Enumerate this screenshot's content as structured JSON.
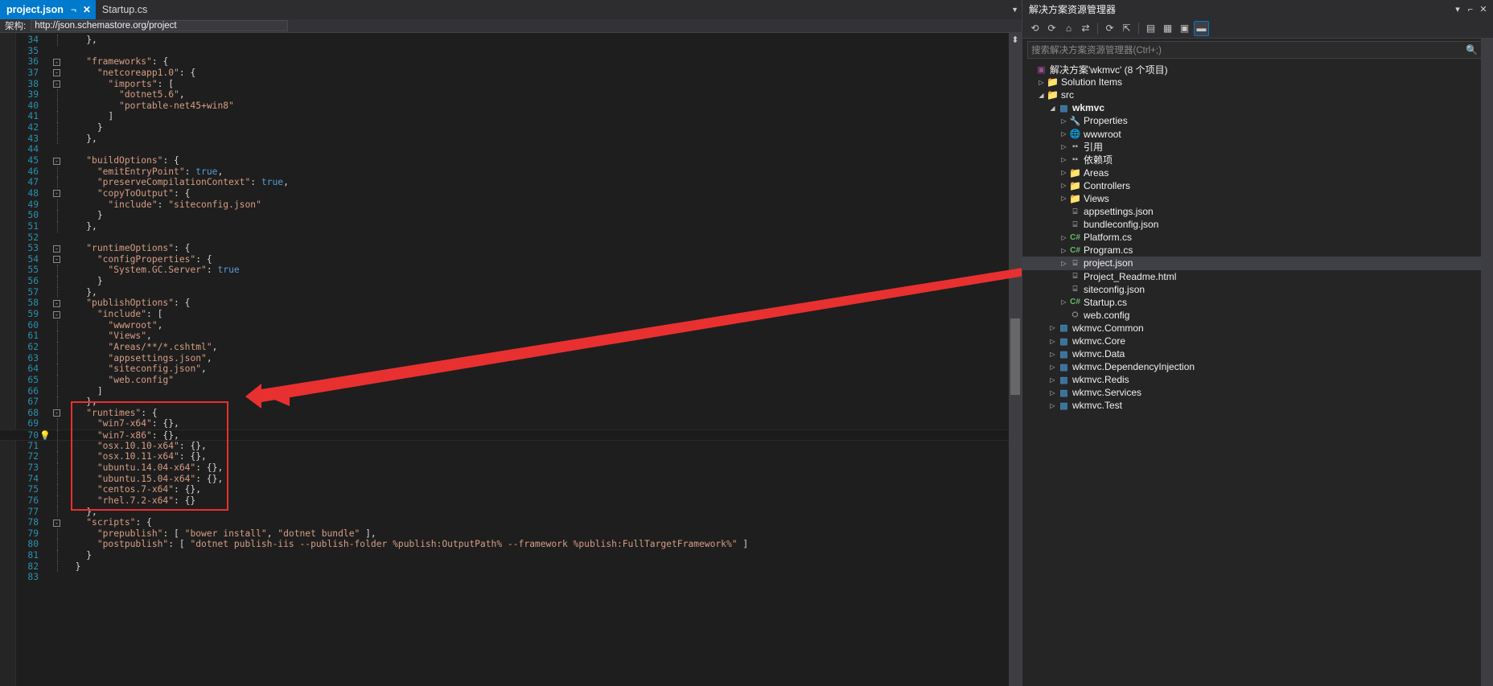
{
  "window": {
    "editor_tabs": [
      {
        "label": "project.json",
        "active": true,
        "pin_icon": "pin-icon",
        "close_icon": "close-icon"
      },
      {
        "label": "Startup.cs",
        "active": false
      }
    ],
    "tab_overflow_icon": "chevron-down-icon"
  },
  "schema_bar": {
    "label": "架构:",
    "value": "http://json.schemastore.org/project"
  },
  "editor": {
    "current_line": 70,
    "lightbulb_line": 70,
    "lightbulb_icon": "lightbulb-icon",
    "lines": [
      {
        "n": 34,
        "fold": "",
        "guide": "dotted",
        "indent": 4,
        "tokens": [
          [
            "punc",
            "},"
          ]
        ]
      },
      {
        "n": 35,
        "fold": "",
        "guide": "",
        "indent": 0,
        "tokens": []
      },
      {
        "n": 36,
        "fold": "-",
        "guide": "dotted",
        "indent": 4,
        "tokens": [
          [
            "str",
            "\"frameworks\""
          ],
          [
            "punc",
            ": {"
          ]
        ]
      },
      {
        "n": 37,
        "fold": "-",
        "guide": "dotted",
        "indent": 6,
        "tokens": [
          [
            "str",
            "\"netcoreapp1.0\""
          ],
          [
            "punc",
            ": {"
          ]
        ]
      },
      {
        "n": 38,
        "fold": "-",
        "guide": "dotted",
        "indent": 8,
        "tokens": [
          [
            "str",
            "\"imports\""
          ],
          [
            "punc",
            ": ["
          ]
        ]
      },
      {
        "n": 39,
        "fold": "",
        "guide": "dotted",
        "indent": 10,
        "tokens": [
          [
            "str",
            "\"dotnet5.6\""
          ],
          [
            "punc",
            ","
          ]
        ]
      },
      {
        "n": 40,
        "fold": "",
        "guide": "dotted",
        "indent": 10,
        "tokens": [
          [
            "str",
            "\"portable-net45+win8\""
          ]
        ]
      },
      {
        "n": 41,
        "fold": "",
        "guide": "dotted",
        "indent": 8,
        "tokens": [
          [
            "punc",
            "]"
          ]
        ]
      },
      {
        "n": 42,
        "fold": "",
        "guide": "dotted",
        "indent": 6,
        "tokens": [
          [
            "punc",
            "}"
          ]
        ]
      },
      {
        "n": 43,
        "fold": "",
        "guide": "dotted",
        "indent": 4,
        "tokens": [
          [
            "punc",
            "},"
          ]
        ]
      },
      {
        "n": 44,
        "fold": "",
        "guide": "",
        "indent": 0,
        "tokens": []
      },
      {
        "n": 45,
        "fold": "-",
        "guide": "dotted",
        "indent": 4,
        "tokens": [
          [
            "str",
            "\"buildOptions\""
          ],
          [
            "punc",
            ": {"
          ]
        ]
      },
      {
        "n": 46,
        "fold": "",
        "guide": "dotted",
        "indent": 6,
        "tokens": [
          [
            "str",
            "\"emitEntryPoint\""
          ],
          [
            "punc",
            ": "
          ],
          [
            "bool",
            "true"
          ],
          [
            "punc",
            ","
          ]
        ]
      },
      {
        "n": 47,
        "fold": "",
        "guide": "dotted",
        "indent": 6,
        "tokens": [
          [
            "str",
            "\"preserveCompilationContext\""
          ],
          [
            "punc",
            ": "
          ],
          [
            "bool",
            "true"
          ],
          [
            "punc",
            ","
          ]
        ]
      },
      {
        "n": 48,
        "fold": "-",
        "guide": "dotted",
        "indent": 6,
        "tokens": [
          [
            "str",
            "\"copyToOutput\""
          ],
          [
            "punc",
            ": {"
          ]
        ]
      },
      {
        "n": 49,
        "fold": "",
        "guide": "dotted",
        "indent": 8,
        "tokens": [
          [
            "str",
            "\"include\""
          ],
          [
            "punc",
            ": "
          ],
          [
            "str",
            "\"siteconfig.json\""
          ]
        ]
      },
      {
        "n": 50,
        "fold": "",
        "guide": "dotted",
        "indent": 6,
        "tokens": [
          [
            "punc",
            "}"
          ]
        ]
      },
      {
        "n": 51,
        "fold": "",
        "guide": "dotted",
        "indent": 4,
        "tokens": [
          [
            "punc",
            "},"
          ]
        ]
      },
      {
        "n": 52,
        "fold": "",
        "guide": "",
        "indent": 0,
        "tokens": []
      },
      {
        "n": 53,
        "fold": "-",
        "guide": "dotted",
        "indent": 4,
        "tokens": [
          [
            "str",
            "\"runtimeOptions\""
          ],
          [
            "punc",
            ": {"
          ]
        ]
      },
      {
        "n": 54,
        "fold": "-",
        "guide": "dotted",
        "indent": 6,
        "tokens": [
          [
            "str",
            "\"configProperties\""
          ],
          [
            "punc",
            ": {"
          ]
        ]
      },
      {
        "n": 55,
        "fold": "",
        "guide": "dotted",
        "indent": 8,
        "tokens": [
          [
            "str",
            "\"System.GC.Server\""
          ],
          [
            "punc",
            ": "
          ],
          [
            "bool",
            "true"
          ]
        ]
      },
      {
        "n": 56,
        "fold": "",
        "guide": "dotted",
        "indent": 6,
        "tokens": [
          [
            "punc",
            "}"
          ]
        ]
      },
      {
        "n": 57,
        "fold": "",
        "guide": "dotted",
        "indent": 4,
        "tokens": [
          [
            "punc",
            "},"
          ]
        ]
      },
      {
        "n": 58,
        "fold": "-",
        "guide": "dotted",
        "indent": 4,
        "tokens": [
          [
            "str",
            "\"publishOptions\""
          ],
          [
            "punc",
            ": {"
          ]
        ]
      },
      {
        "n": 59,
        "fold": "-",
        "guide": "dotted",
        "indent": 6,
        "tokens": [
          [
            "str",
            "\"include\""
          ],
          [
            "punc",
            ": ["
          ]
        ]
      },
      {
        "n": 60,
        "fold": "",
        "guide": "dotted",
        "indent": 8,
        "tokens": [
          [
            "str",
            "\"wwwroot\""
          ],
          [
            "punc",
            ","
          ]
        ]
      },
      {
        "n": 61,
        "fold": "",
        "guide": "dotted",
        "indent": 8,
        "tokens": [
          [
            "str",
            "\"Views\""
          ],
          [
            "punc",
            ","
          ]
        ]
      },
      {
        "n": 62,
        "fold": "",
        "guide": "dotted",
        "indent": 8,
        "tokens": [
          [
            "str",
            "\"Areas/**/*.cshtml\""
          ],
          [
            "punc",
            ","
          ]
        ]
      },
      {
        "n": 63,
        "fold": "",
        "guide": "dotted",
        "indent": 8,
        "tokens": [
          [
            "str",
            "\"appsettings.json\""
          ],
          [
            "punc",
            ","
          ]
        ]
      },
      {
        "n": 64,
        "fold": "",
        "guide": "dotted",
        "indent": 8,
        "tokens": [
          [
            "str",
            "\"siteconfig.json\""
          ],
          [
            "punc",
            ","
          ]
        ]
      },
      {
        "n": 65,
        "fold": "",
        "guide": "dotted",
        "indent": 8,
        "tokens": [
          [
            "str",
            "\"web.config\""
          ]
        ]
      },
      {
        "n": 66,
        "fold": "",
        "guide": "dotted",
        "indent": 6,
        "tokens": [
          [
            "punc",
            "]"
          ]
        ]
      },
      {
        "n": 67,
        "fold": "",
        "guide": "dotted",
        "indent": 4,
        "tokens": [
          [
            "punc",
            "},"
          ]
        ]
      },
      {
        "n": 68,
        "fold": "-",
        "guide": "dotted",
        "indent": 4,
        "tokens": [
          [
            "str",
            "\"runtimes\""
          ],
          [
            "punc",
            ": {"
          ]
        ]
      },
      {
        "n": 69,
        "fold": "",
        "guide": "dotted",
        "indent": 6,
        "tokens": [
          [
            "str",
            "\"win7-x64\""
          ],
          [
            "punc",
            ": {},"
          ]
        ]
      },
      {
        "n": 70,
        "fold": "",
        "guide": "dotted",
        "indent": 6,
        "tokens": [
          [
            "str",
            "\"win7-x86\""
          ],
          [
            "punc",
            ": {},"
          ]
        ]
      },
      {
        "n": 71,
        "fold": "",
        "guide": "dotted",
        "indent": 6,
        "tokens": [
          [
            "str",
            "\"osx.10.10-x64\""
          ],
          [
            "punc",
            ": {},"
          ]
        ]
      },
      {
        "n": 72,
        "fold": "",
        "guide": "dotted",
        "indent": 6,
        "tokens": [
          [
            "str",
            "\"osx.10.11-x64\""
          ],
          [
            "punc",
            ": {},"
          ]
        ]
      },
      {
        "n": 73,
        "fold": "",
        "guide": "dotted",
        "indent": 6,
        "tokens": [
          [
            "str",
            "\"ubuntu.14.04-x64\""
          ],
          [
            "punc",
            ": {},"
          ]
        ]
      },
      {
        "n": 74,
        "fold": "",
        "guide": "dotted",
        "indent": 6,
        "tokens": [
          [
            "str",
            "\"ubuntu.15.04-x64\""
          ],
          [
            "punc",
            ": {},"
          ]
        ]
      },
      {
        "n": 75,
        "fold": "",
        "guide": "dotted",
        "indent": 6,
        "tokens": [
          [
            "str",
            "\"centos.7-x64\""
          ],
          [
            "punc",
            ": {},"
          ]
        ]
      },
      {
        "n": 76,
        "fold": "",
        "guide": "dotted",
        "indent": 6,
        "tokens": [
          [
            "str",
            "\"rhel.7.2-x64\""
          ],
          [
            "punc",
            ": {}"
          ]
        ]
      },
      {
        "n": 77,
        "fold": "",
        "guide": "dotted",
        "indent": 4,
        "tokens": [
          [
            "punc",
            "},"
          ]
        ]
      },
      {
        "n": 78,
        "fold": "-",
        "guide": "dotted",
        "indent": 4,
        "tokens": [
          [
            "str",
            "\"scripts\""
          ],
          [
            "punc",
            ": {"
          ]
        ]
      },
      {
        "n": 79,
        "fold": "",
        "guide": "dotted",
        "indent": 6,
        "tokens": [
          [
            "str",
            "\"prepublish\""
          ],
          [
            "punc",
            ": [ "
          ],
          [
            "str",
            "\"bower install\""
          ],
          [
            "punc",
            ", "
          ],
          [
            "str",
            "\"dotnet bundle\""
          ],
          [
            "punc",
            " ],"
          ]
        ]
      },
      {
        "n": 80,
        "fold": "",
        "guide": "dotted",
        "indent": 6,
        "tokens": [
          [
            "str",
            "\"postpublish\""
          ],
          [
            "punc",
            ": [ "
          ],
          [
            "str",
            "\"dotnet publish-iis --publish-folder %publish:OutputPath% --framework %publish:FullTargetFramework%\""
          ],
          [
            "punc",
            " ]"
          ]
        ]
      },
      {
        "n": 81,
        "fold": "",
        "guide": "dotted",
        "indent": 4,
        "tokens": [
          [
            "punc",
            "}"
          ]
        ]
      },
      {
        "n": 82,
        "fold": "",
        "guide": "dotted",
        "indent": 2,
        "tokens": [
          [
            "punc",
            "}"
          ]
        ]
      },
      {
        "n": 83,
        "fold": "",
        "guide": "",
        "indent": 0,
        "tokens": []
      }
    ]
  },
  "annotation": {
    "box_label": "runtimes-highlight-box",
    "arrow_label": "pointer-arrow",
    "color": "#e83030"
  },
  "solution_explorer": {
    "title": "解决方案资源管理器",
    "title_buttons": [
      {
        "icon": "chevron-down-icon"
      },
      {
        "icon": "pin-icon"
      },
      {
        "icon": "close-icon"
      }
    ],
    "toolbar": [
      {
        "icon": "back-icon",
        "active": false
      },
      {
        "icon": "forward-icon",
        "active": false
      },
      {
        "icon": "home-icon",
        "active": false
      },
      {
        "icon": "sync-icon",
        "active": false
      },
      {
        "icon": "refresh-icon",
        "active": false
      },
      {
        "icon": "collapse-all-icon",
        "active": false
      },
      {
        "icon": "show-all-files-icon",
        "active": false
      },
      {
        "icon": "properties-icon",
        "active": false
      },
      {
        "icon": "preview-selected-icon",
        "active": false
      },
      {
        "icon": "pending-changes-icon",
        "active": true
      }
    ],
    "search": {
      "placeholder": "搜索解决方案资源管理器(Ctrl+;)",
      "search_icon": "search-icon",
      "dropdown_icon": "chevron-down-icon"
    },
    "tree": [
      {
        "depth": 0,
        "twisty": "none",
        "icon": "solution-icon",
        "label": "解决方案'wkmvc' (8 个项目)",
        "selected": false
      },
      {
        "depth": 1,
        "twisty": "collapsed",
        "icon": "folder-icon",
        "label": "Solution Items",
        "selected": false
      },
      {
        "depth": 1,
        "twisty": "expanded",
        "icon": "folder-icon",
        "label": "src",
        "selected": false
      },
      {
        "depth": 2,
        "twisty": "expanded",
        "icon": "project-icon",
        "label": "wkmvc",
        "selected": false,
        "bold": true
      },
      {
        "depth": 3,
        "twisty": "collapsed",
        "icon": "properties-icon",
        "label": "Properties",
        "selected": false
      },
      {
        "depth": 3,
        "twisty": "collapsed",
        "icon": "wwwroot-icon",
        "label": "wwwroot",
        "selected": false
      },
      {
        "depth": 3,
        "twisty": "collapsed",
        "icon": "references-icon",
        "label": "引用",
        "selected": false
      },
      {
        "depth": 3,
        "twisty": "collapsed",
        "icon": "dependencies-icon",
        "label": "依赖项",
        "selected": false
      },
      {
        "depth": 3,
        "twisty": "collapsed",
        "icon": "folder-icon",
        "label": "Areas",
        "selected": false
      },
      {
        "depth": 3,
        "twisty": "collapsed",
        "icon": "folder-icon",
        "label": "Controllers",
        "selected": false
      },
      {
        "depth": 3,
        "twisty": "collapsed",
        "icon": "folder-icon",
        "label": "Views",
        "selected": false
      },
      {
        "depth": 3,
        "twisty": "none",
        "icon": "json-file-icon",
        "label": "appsettings.json",
        "selected": false
      },
      {
        "depth": 3,
        "twisty": "none",
        "icon": "json-file-icon",
        "label": "bundleconfig.json",
        "selected": false
      },
      {
        "depth": 3,
        "twisty": "collapsed",
        "icon": "csharp-file-icon",
        "label": "Platform.cs",
        "selected": false
      },
      {
        "depth": 3,
        "twisty": "collapsed",
        "icon": "csharp-file-icon",
        "label": "Program.cs",
        "selected": false
      },
      {
        "depth": 3,
        "twisty": "collapsed",
        "icon": "json-file-icon",
        "label": "project.json",
        "selected": true
      },
      {
        "depth": 3,
        "twisty": "none",
        "icon": "html-file-icon",
        "label": "Project_Readme.html",
        "selected": false
      },
      {
        "depth": 3,
        "twisty": "none",
        "icon": "json-file-icon",
        "label": "siteconfig.json",
        "selected": false
      },
      {
        "depth": 3,
        "twisty": "collapsed",
        "icon": "csharp-file-icon",
        "label": "Startup.cs",
        "selected": false
      },
      {
        "depth": 3,
        "twisty": "none",
        "icon": "config-file-icon",
        "label": "web.config",
        "selected": false
      },
      {
        "depth": 2,
        "twisty": "collapsed",
        "icon": "project-icon",
        "label": "wkmvc.Common",
        "selected": false
      },
      {
        "depth": 2,
        "twisty": "collapsed",
        "icon": "project-icon",
        "label": "wkmvc.Core",
        "selected": false
      },
      {
        "depth": 2,
        "twisty": "collapsed",
        "icon": "project-icon",
        "label": "wkmvc.Data",
        "selected": false
      },
      {
        "depth": 2,
        "twisty": "collapsed",
        "icon": "project-icon",
        "label": "wkmvc.DependencyInjection",
        "selected": false
      },
      {
        "depth": 2,
        "twisty": "collapsed",
        "icon": "project-icon",
        "label": "wkmvc.Redis",
        "selected": false
      },
      {
        "depth": 2,
        "twisty": "collapsed",
        "icon": "project-icon",
        "label": "wkmvc.Services",
        "selected": false
      },
      {
        "depth": 2,
        "twisty": "collapsed",
        "icon": "project-icon",
        "label": "wkmvc.Test",
        "selected": false
      }
    ]
  }
}
